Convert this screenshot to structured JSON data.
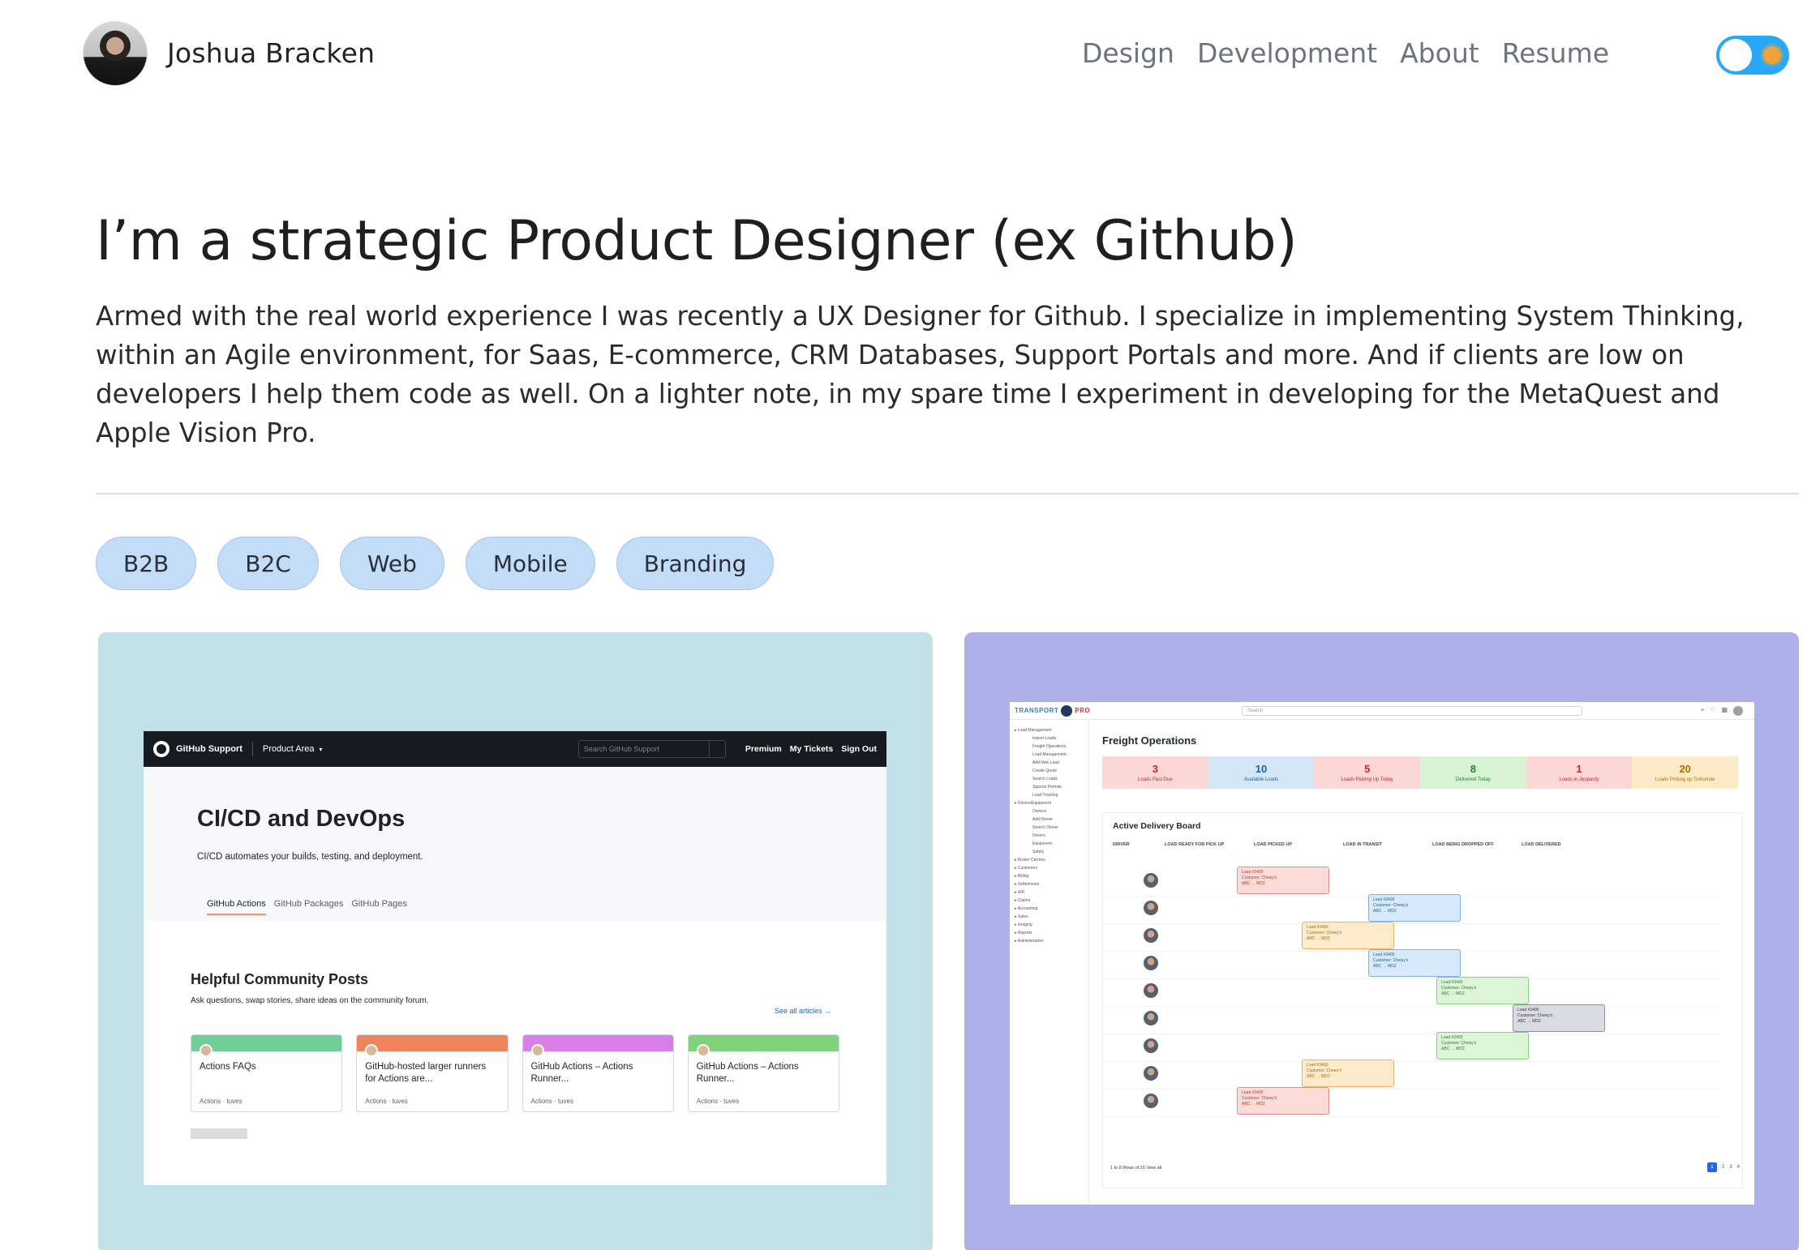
{
  "header": {
    "name": "Joshua Bracken",
    "nav": [
      "Design",
      "Development",
      "About",
      "Resume"
    ],
    "accent_color": "#29a9f5"
  },
  "hero": {
    "title": "I’m a strategic Product Designer (ex Github)",
    "body": "Armed with the real world experience I was recently a UX Designer for Github. I specialize in implementing System Thinking, within an Agile environment, for Saas, E-commerce, CRM Databases, Support Portals and more. And if clients are low on developers I help them code as well. On a lighter note, in my spare time I experiment in developing for the MetaQuest and Apple Vision Pro."
  },
  "tags": [
    "B2B",
    "B2C",
    "Web",
    "Mobile",
    "Branding"
  ],
  "github_card": {
    "bar": {
      "brand": "GitHub Support",
      "area": "Product Area",
      "search_placeholder": "Search GitHub Support",
      "links": [
        "Premium",
        "My Tickets",
        "Sign Out"
      ]
    },
    "title": "CI/CD and DevOps",
    "subtitle": "CI/CD automates your builds, testing, and deployment.",
    "tabs": [
      "GitHub Actions",
      "GitHub Packages",
      "GitHub Pages"
    ],
    "section_title": "Helpful Community Posts",
    "section_desc": "Ask questions, swap stories, share ideas on the community forum.",
    "see_all": "See all articles",
    "posts": [
      {
        "title": "Actions FAQs",
        "meta": "Actions · tuves",
        "color": "#6fcf97"
      },
      {
        "title": "GitHub-hosted larger runners for Actions are...",
        "meta": "Actions · tuves",
        "color": "#f0845a"
      },
      {
        "title": "GitHub Actions – Actions Runner...",
        "meta": "Actions · tuves",
        "color": "#d97ee9"
      },
      {
        "title": "GitHub Actions – Actions Runner...",
        "meta": "Actions · tuves",
        "color": "#7fd37a"
      }
    ]
  },
  "transport_card": {
    "logo_left": "TRANSPORT",
    "logo_right": "PRO",
    "search_placeholder": "Search",
    "title": "Freight Operations",
    "sidebar": [
      "Load Management",
      "Import Loads",
      "Freight Operations",
      "Load Management",
      "Add New Load",
      "Create Quote",
      "Search Loads",
      "Spports Permits",
      "Load Tracking",
      "Drivers/Equipment",
      "Owners",
      "Add Owner",
      "Search Owner",
      "Drivers",
      "Equipment",
      "Safety",
      "Broker Carriers",
      "Customers",
      "Billing",
      "Settlements",
      "A/R",
      "Claims",
      "Accounting",
      "Sales",
      "Imaging",
      "Reports",
      "Administration"
    ],
    "kpis": [
      {
        "value": "3",
        "label": "Loads Past Due",
        "bg": "#fbd8d6",
        "fg": "#c62828"
      },
      {
        "value": "10",
        "label": "Available Loads",
        "bg": "#d5e6f7",
        "fg": "#1f5fa8"
      },
      {
        "value": "5",
        "label": "Loads Picking Up Today",
        "bg": "#fbd8d6",
        "fg": "#c62828"
      },
      {
        "value": "8",
        "label": "Delivered Today",
        "bg": "#d8f3d3",
        "fg": "#2e7d32"
      },
      {
        "value": "1",
        "label": "Loads in Jeopardy",
        "bg": "#fbd8d6",
        "fg": "#c62828"
      },
      {
        "value": "20",
        "label": "Loads Picking up Tomorrow",
        "bg": "#fdebc8",
        "fg": "#b26a00"
      }
    ],
    "board_title": "Active Delivery Board",
    "columns": [
      "DRIVER",
      "LOAD READY FOR PICK UP",
      "LOAD PICKED UP",
      "LOAD IN TRANSIT",
      "LOAD BEING DROPPED OFF",
      "LOAD DELIVERED"
    ],
    "loads": [
      {
        "col": 1,
        "label": "Load #3400",
        "customer": "Customer: Chewy's",
        "route": "ABC → MD2"
      },
      {
        "col": 3,
        "label": "Load #3400",
        "customer": "Customer: Chewy's",
        "route": "ABC → MD2"
      },
      {
        "col": 2,
        "label": "Load #3400",
        "customer": "Customer: Chewy's",
        "route": "ABC → MD2"
      },
      {
        "col": 3,
        "label": "Load #3400",
        "customer": "Customer: Chewy's",
        "route": "ABC → MD2"
      },
      {
        "col": 4,
        "label": "Load #3400",
        "customer": "Customer: Chewy's",
        "route": "ABC → MD2"
      },
      {
        "col": 5,
        "label": "Load #3400",
        "customer": "Customer: Chewy's",
        "route": "ABC → MD2"
      },
      {
        "col": 4,
        "label": "Load #3400",
        "customer": "Customer: Chewy's",
        "route": "ABC → MD2"
      },
      {
        "col": 2,
        "label": "Load #3400",
        "customer": "Customer: Chewy's",
        "route": "ABC → MD2"
      },
      {
        "col": 1,
        "label": "Load #3400",
        "customer": "Customer: Chewy's",
        "route": "ABC → MD2"
      }
    ],
    "footer": "1 to 8 Rows of 20   View all",
    "pages": [
      "1",
      "2",
      "3",
      "4"
    ]
  }
}
